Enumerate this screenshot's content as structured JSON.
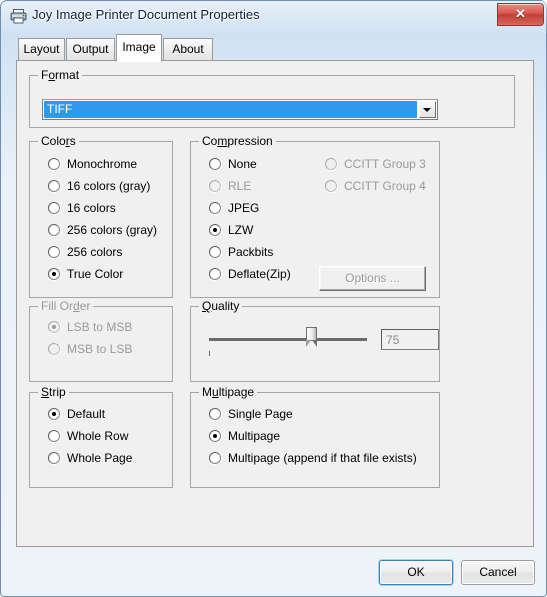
{
  "window": {
    "title": "Joy Image Printer Document Properties",
    "icon": "printer-icon",
    "close_label": "✕"
  },
  "tabs": [
    {
      "label": "Layout",
      "active": false
    },
    {
      "label": "Output",
      "active": false
    },
    {
      "label": "Image",
      "active": true
    },
    {
      "label": "About",
      "active": false
    }
  ],
  "format": {
    "group_label": "Format",
    "selected": "TIFF",
    "arrow": "chevron-down-icon",
    "highlight_color": "#2f9ae8"
  },
  "colors": {
    "group_label": "Colors",
    "options": [
      {
        "label": "Monochrome",
        "checked": false,
        "disabled": false
      },
      {
        "label": "16 colors (gray)",
        "checked": false,
        "disabled": false
      },
      {
        "label": "16 colors",
        "checked": false,
        "disabled": false
      },
      {
        "label": "256 colors (gray)",
        "checked": false,
        "disabled": false
      },
      {
        "label": "256 colors",
        "checked": false,
        "disabled": false
      },
      {
        "label": "True Color",
        "checked": true,
        "disabled": false
      }
    ]
  },
  "compression": {
    "group_label": "Compression",
    "left_options": [
      {
        "label": "None",
        "checked": false,
        "disabled": false
      },
      {
        "label": "RLE",
        "checked": false,
        "disabled": true
      },
      {
        "label": "JPEG",
        "checked": false,
        "disabled": false
      },
      {
        "label": "LZW",
        "checked": true,
        "disabled": false
      },
      {
        "label": "Packbits",
        "checked": false,
        "disabled": false
      },
      {
        "label": "Deflate(Zip)",
        "checked": false,
        "disabled": false
      }
    ],
    "right_options": [
      {
        "label": "CCITT Group 3",
        "checked": false,
        "disabled": true
      },
      {
        "label": "CCITT Group 4",
        "checked": false,
        "disabled": true
      }
    ],
    "options_button": "Options ...",
    "options_button_disabled": true
  },
  "fill_order": {
    "group_label": "Fill Order",
    "disabled": true,
    "options": [
      {
        "label": "LSB to MSB",
        "checked": true,
        "disabled": true
      },
      {
        "label": "MSB to LSB",
        "checked": false,
        "disabled": true
      }
    ]
  },
  "quality": {
    "group_label": "Quality",
    "value": "75",
    "value_disabled": true,
    "slider_percent": 72,
    "tick_count": 11,
    "min": 0,
    "max": 100
  },
  "strip": {
    "group_label": "Strip",
    "options": [
      {
        "label": "Default",
        "checked": true,
        "disabled": false
      },
      {
        "label": "Whole Row",
        "checked": false,
        "disabled": false
      },
      {
        "label": "Whole Page",
        "checked": false,
        "disabled": false
      }
    ]
  },
  "multipage": {
    "group_label": "Multipage",
    "options": [
      {
        "label": "Single Page",
        "checked": false,
        "disabled": false
      },
      {
        "label": "Multipage",
        "checked": true,
        "disabled": false
      },
      {
        "label": "Multipage (append if that file exists)",
        "checked": false,
        "disabled": false
      }
    ]
  },
  "footer": {
    "ok_label": "OK",
    "cancel_label": "Cancel"
  }
}
